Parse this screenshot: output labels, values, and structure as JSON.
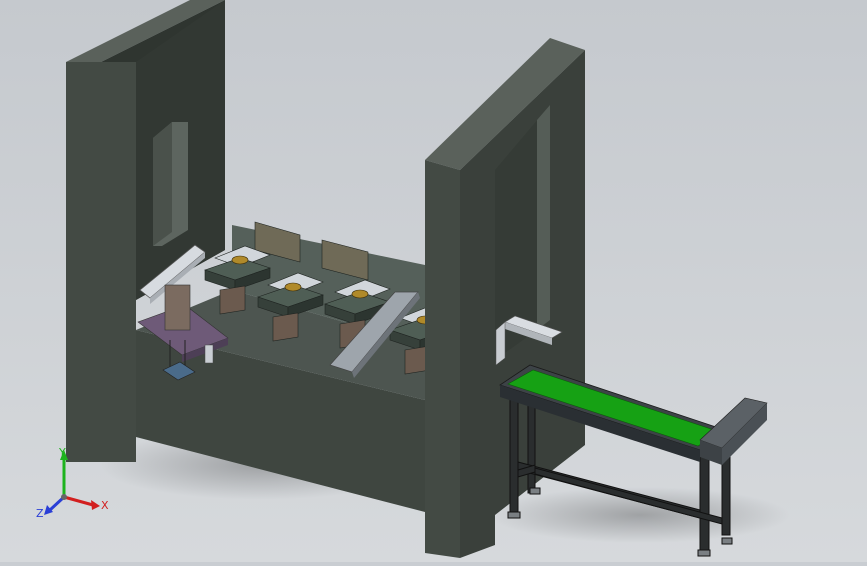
{
  "viewport": {
    "background_top": "#c5c9ce",
    "background_bottom": "#d6d9dc"
  },
  "triad": {
    "x_label": "X",
    "y_label": "Y",
    "z_label": "Z",
    "x_color": "#d21f1f",
    "y_color": "#1db31d",
    "z_color": "#2a3fd6"
  },
  "model": {
    "frame_color": "#3f4640",
    "frame_dark": "#2b302c",
    "frame_light": "#59605a",
    "conveyor_belt_color": "#16a114",
    "stage_color": "#4f5e55"
  }
}
